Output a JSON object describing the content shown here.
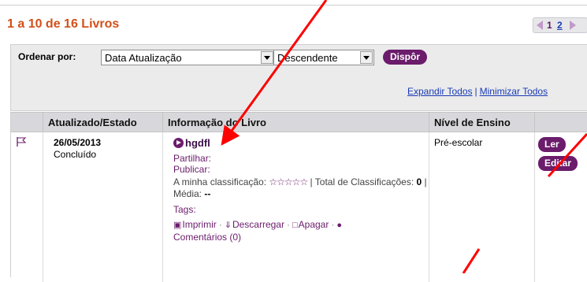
{
  "header": {
    "count_title": "1 a 10 de 16 Livros"
  },
  "pager": {
    "page_current": "1",
    "page_next": "2"
  },
  "sort": {
    "label": "Ordenar por:",
    "field_value": "Data Atualização",
    "order_value": "Descendente",
    "apply_label": "Dispôr"
  },
  "links": {
    "expand_all": "Expandir Todos",
    "separator": "|",
    "collapse_all": "Minimizar Todos"
  },
  "table": {
    "headers": {
      "updated_status": "Atualizado/Estado",
      "book_info": "Informação do Livro",
      "level": "Nível de Ensino"
    },
    "rows": [
      {
        "date": "26/05/2013",
        "status": "Concluído",
        "title": "hgdfl",
        "share": "Partilhar:",
        "publish": "Publicar:",
        "my_rating_label": "A minha classificação:",
        "stars": "☆☆☆☆☆",
        "total_ratings_label": "| Total de Classificações:",
        "total_ratings": "0",
        "average_label": "| Média:",
        "average_value": "--",
        "tags": "Tags:",
        "print": "Imprimir",
        "download": "Descarregar",
        "delete": "Apagar",
        "comments": "Comentários (0)",
        "level": "Pré-escolar",
        "read_label": "Ler",
        "edit_label": "Editar"
      }
    ]
  },
  "colors": {
    "accent": "#6b1c6b",
    "title_orange": "#d2501a",
    "link_blue": "#1a3bb5",
    "annotation_red": "#ff0000"
  },
  "icons": [
    "flag-icon",
    "play-icon",
    "print-icon",
    "download-icon",
    "trash-icon",
    "comment-icon",
    "prev-page-icon",
    "next-page-icon"
  ]
}
